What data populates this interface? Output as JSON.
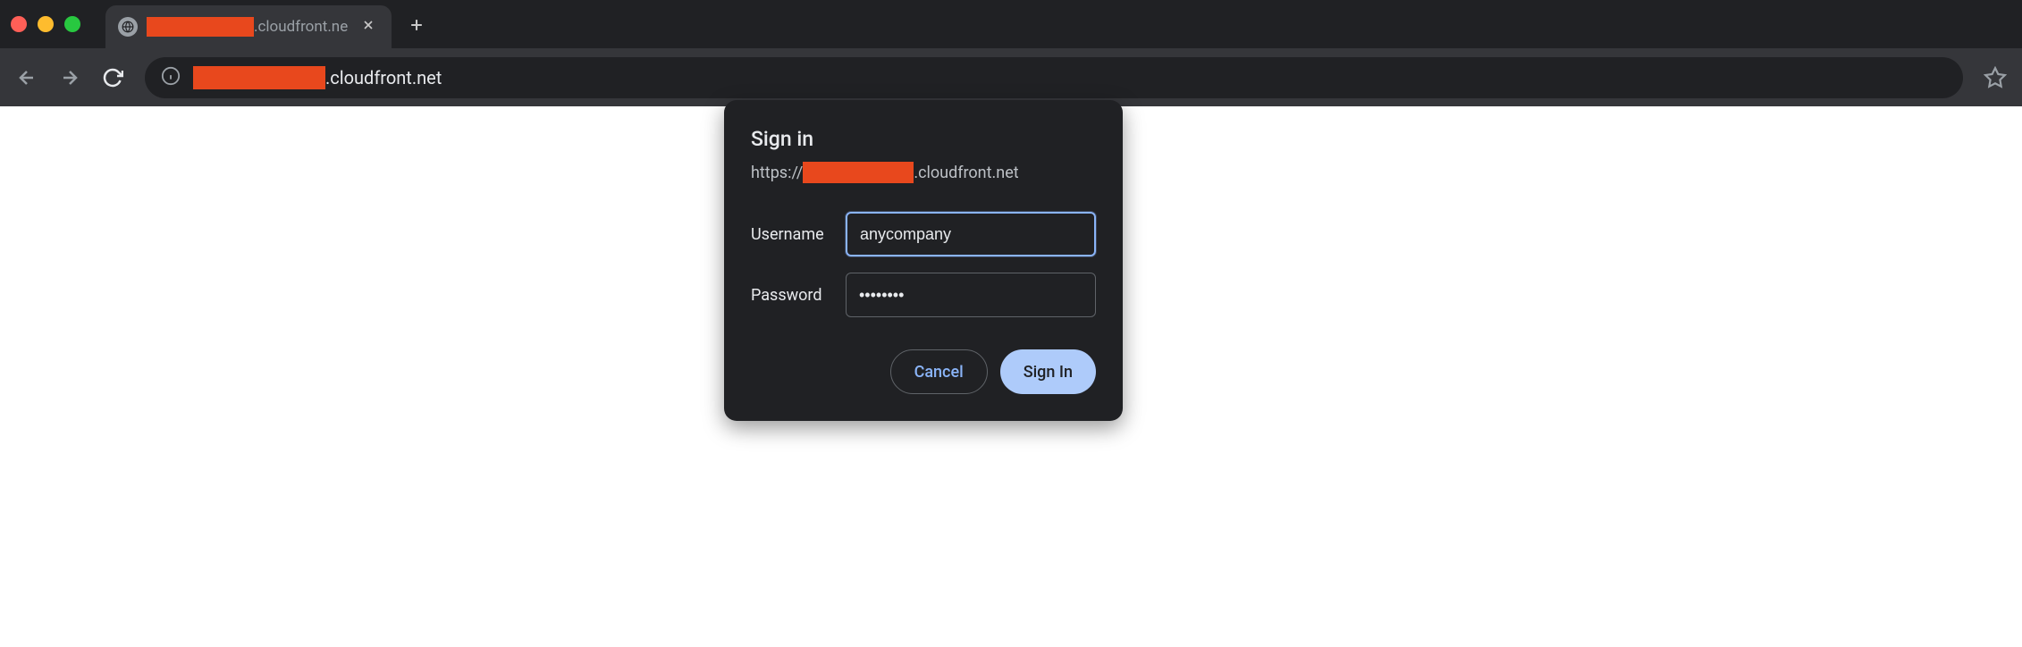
{
  "tab": {
    "title_suffix": ".cloudfront.ne"
  },
  "addressbar": {
    "url_suffix": ".cloudfront.net"
  },
  "dialog": {
    "title": "Sign in",
    "origin_prefix": "https://",
    "origin_suffix": ".cloudfront.net",
    "username_label": "Username",
    "username_value": "anycompany",
    "password_label": "Password",
    "password_value": "••••••••",
    "cancel_label": "Cancel",
    "signin_label": "Sign In"
  }
}
